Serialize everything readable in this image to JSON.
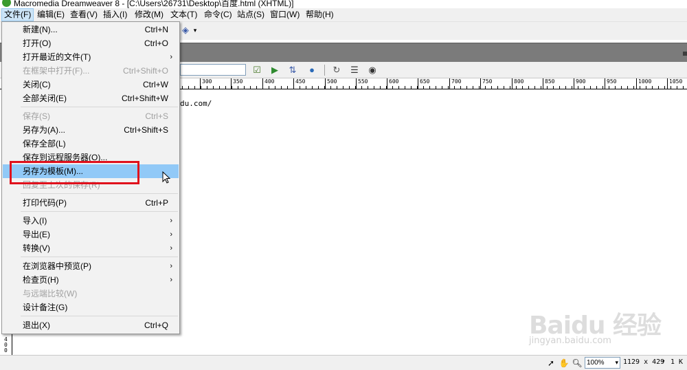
{
  "window": {
    "title": "Macromedia Dreamweaver 8 - [C:\\Users\\26731\\Desktop\\百度.html (XHTML)]"
  },
  "menubar": {
    "items": [
      {
        "label": "文件(F)"
      },
      {
        "label": "编辑(E)"
      },
      {
        "label": "查看(V)"
      },
      {
        "label": "插入(I)"
      },
      {
        "label": "修改(M)"
      },
      {
        "label": "文本(T)"
      },
      {
        "label": "命令(C)"
      },
      {
        "label": "站点(S)"
      },
      {
        "label": "窗口(W)"
      },
      {
        "label": "帮助(H)"
      }
    ]
  },
  "file_menu": {
    "items": [
      {
        "label": "新建(N)...",
        "shortcut": "Ctrl+N"
      },
      {
        "label": "打开(O)",
        "shortcut": "Ctrl+O"
      },
      {
        "label": "打开最近的文件(T)",
        "shortcut": ""
      },
      {
        "label": "在框架中打开(F)...",
        "shortcut": "Ctrl+Shift+O"
      },
      {
        "label": "关闭(C)",
        "shortcut": "Ctrl+W"
      },
      {
        "label": "全部关闭(E)",
        "shortcut": "Ctrl+Shift+W"
      },
      {
        "label": "保存(S)",
        "shortcut": "Ctrl+S"
      },
      {
        "label": "另存为(A)...",
        "shortcut": "Ctrl+Shift+S"
      },
      {
        "label": "保存全部(L)",
        "shortcut": ""
      },
      {
        "label": "保存到远程服务器(O)...",
        "shortcut": ""
      },
      {
        "label": "另存为模板(M)...",
        "shortcut": ""
      },
      {
        "label": "回复至上次的保存(R)",
        "shortcut": ""
      },
      {
        "label": "打印代码(P)",
        "shortcut": "Ctrl+P"
      },
      {
        "label": "导入(I)",
        "shortcut": ""
      },
      {
        "label": "导出(E)",
        "shortcut": ""
      },
      {
        "label": "转换(V)",
        "shortcut": ""
      },
      {
        "label": "在浏览器中预览(P)",
        "shortcut": ""
      },
      {
        "label": "检查页(H)",
        "shortcut": ""
      },
      {
        "label": "与远端比较(W)",
        "shortcut": ""
      },
      {
        "label": "设计备注(G)",
        "shortcut": ""
      },
      {
        "label": "退出(X)",
        "shortcut": "Ctrl+Q"
      }
    ]
  },
  "document": {
    "visible_text": "du.com/"
  },
  "ruler": {
    "labels": [
      "300",
      "350",
      "400",
      "450",
      "500",
      "550",
      "600",
      "650",
      "700",
      "750",
      "800",
      "850",
      "900",
      "950",
      "1000",
      "1050"
    ],
    "vertical_label": "400"
  },
  "statusbar": {
    "zoom": "100%",
    "dimensions": "1129 x 429",
    "size": "1 K"
  },
  "watermark": {
    "main": "Baidu 经验",
    "sub": "jingyan.baidu.com"
  },
  "colors": {
    "highlight": "#91c9f7",
    "annotation_box": "#e0101c",
    "active_menu": "#cce4f7"
  }
}
